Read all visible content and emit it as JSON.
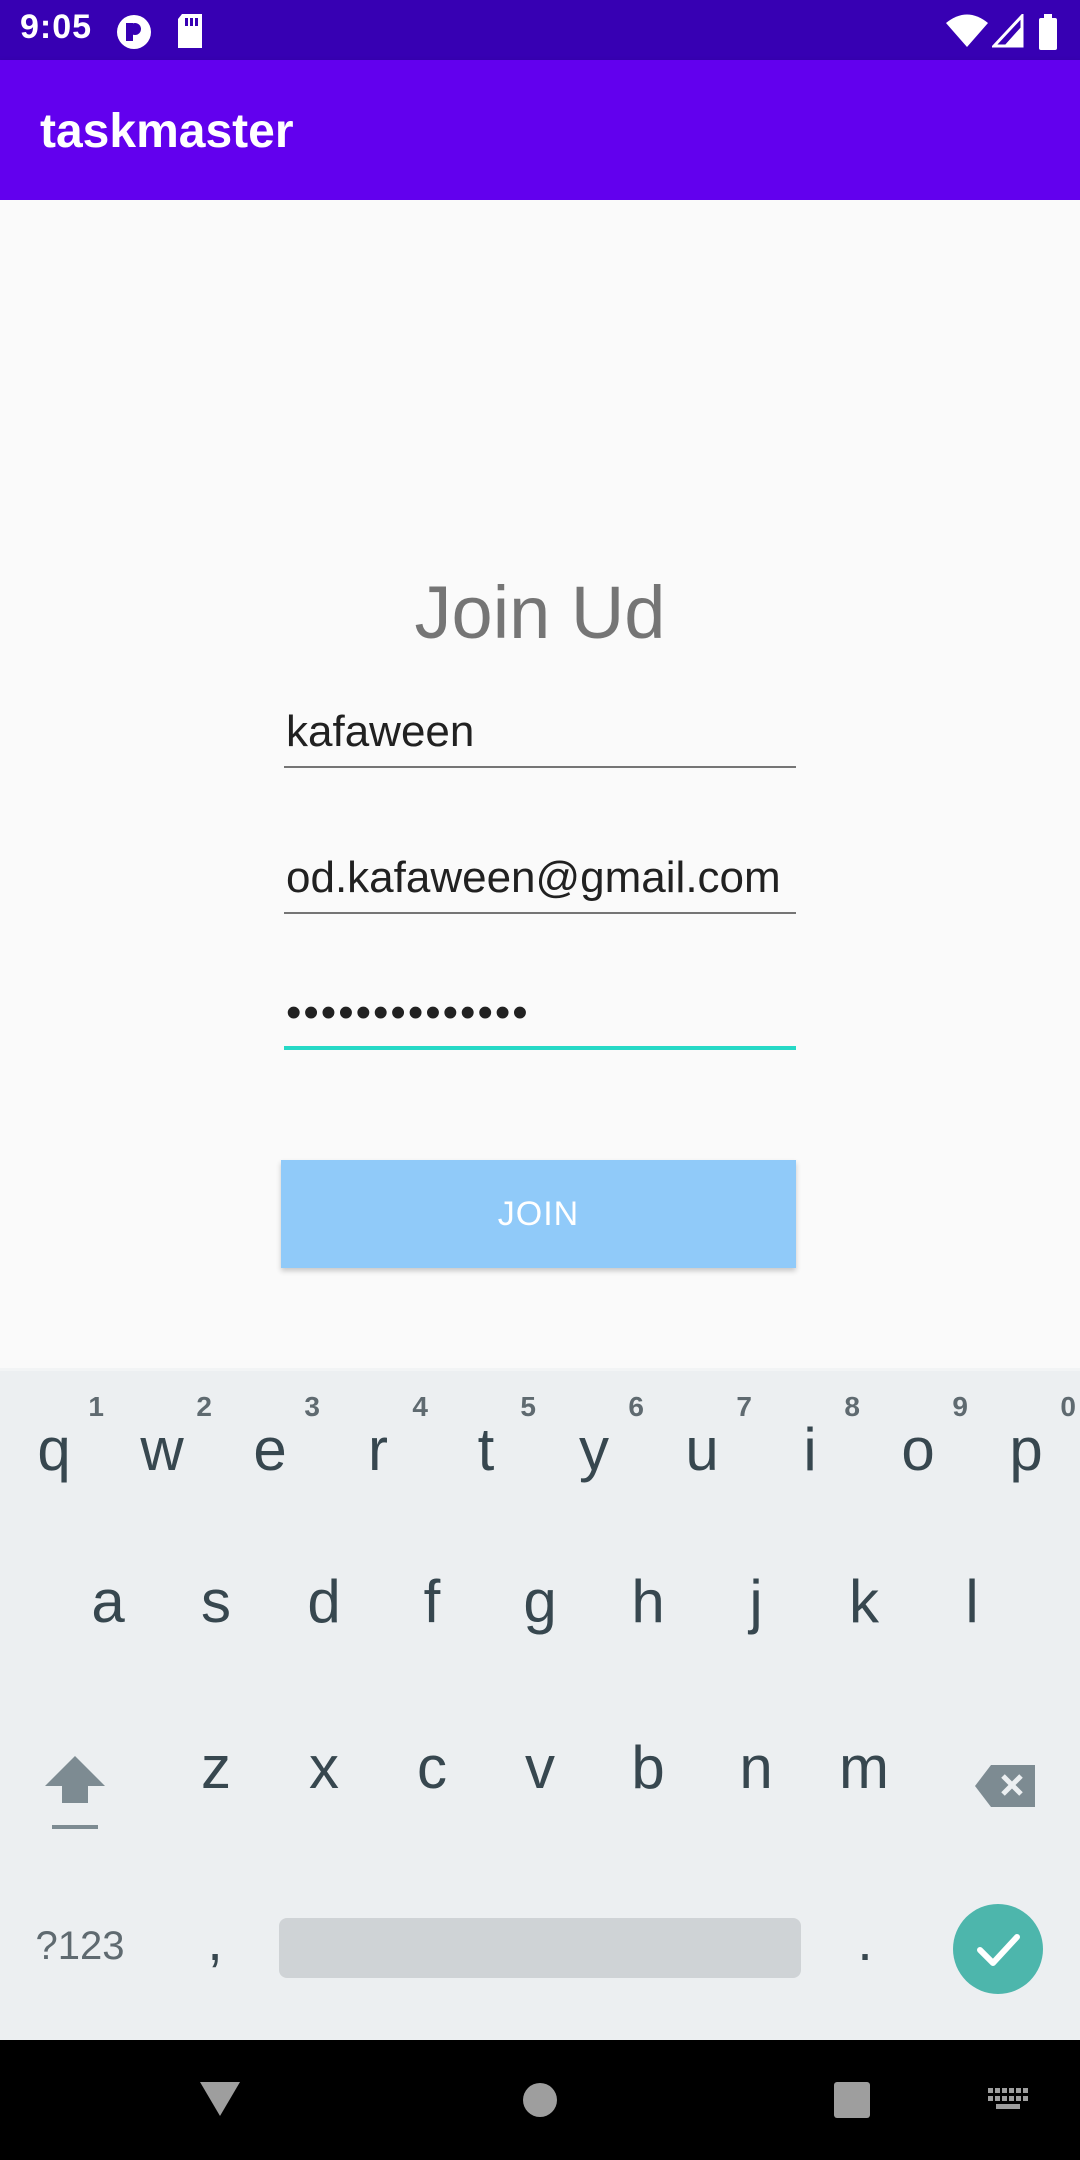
{
  "status_bar": {
    "time": "9:05",
    "left_icons": [
      "app-notification-icon",
      "sd-card-icon"
    ],
    "right_icons": [
      "wifi-icon",
      "cellular-signal-icon",
      "battery-icon"
    ]
  },
  "app_bar": {
    "title": "taskmaster"
  },
  "form": {
    "heading": "Join Ud",
    "username_value": "kafaween",
    "email_value": "od.kafaween@gmail.com",
    "password_value": "••••••••••••••",
    "join_label": "JOIN"
  },
  "keyboard": {
    "row1": [
      {
        "key": "q",
        "hint": "1"
      },
      {
        "key": "w",
        "hint": "2"
      },
      {
        "key": "e",
        "hint": "3"
      },
      {
        "key": "r",
        "hint": "4"
      },
      {
        "key": "t",
        "hint": "5"
      },
      {
        "key": "y",
        "hint": "6"
      },
      {
        "key": "u",
        "hint": "7"
      },
      {
        "key": "i",
        "hint": "8"
      },
      {
        "key": "o",
        "hint": "9"
      },
      {
        "key": "p",
        "hint": "0"
      }
    ],
    "row2": [
      "a",
      "s",
      "d",
      "f",
      "g",
      "h",
      "j",
      "k",
      "l"
    ],
    "row3": [
      "z",
      "x",
      "c",
      "v",
      "b",
      "n",
      "m"
    ],
    "symbols_label": "?123",
    "comma": ",",
    "period": ".",
    "shift_icon": "shift-icon",
    "backspace_icon": "backspace-icon",
    "enter_icon": "check-icon"
  },
  "nav_bar": {
    "buttons": [
      "back-icon",
      "home-icon",
      "recents-icon",
      "keyboard-switch-icon"
    ]
  },
  "colors": {
    "status_bar": "#3700b3",
    "app_bar": "#6200ee",
    "join_button": "#90caf9",
    "focus_underline": "#26d9c6",
    "enter_key": "#4db6ac"
  }
}
